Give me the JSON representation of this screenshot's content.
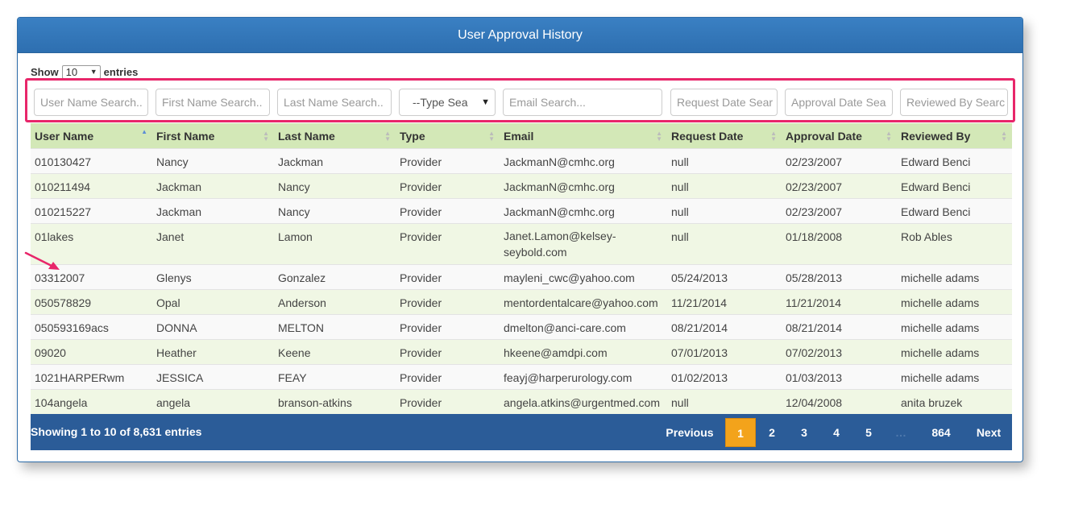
{
  "title": "User Approval History",
  "show_entries": {
    "show_label": "Show",
    "value": "10",
    "entries_label": "entries"
  },
  "filters": [
    {
      "placeholder": "User Name Search..",
      "type": "text"
    },
    {
      "placeholder": "First Name Search..",
      "type": "text"
    },
    {
      "placeholder": "Last Name Search..",
      "type": "text"
    },
    {
      "placeholder": "--Type Sea",
      "type": "select"
    },
    {
      "placeholder": "Email Search...",
      "type": "text"
    },
    {
      "placeholder": "Request Date Sear",
      "type": "text"
    },
    {
      "placeholder": "Approval Date Sea",
      "type": "text"
    },
    {
      "placeholder": "Reviewed By Searc",
      "type": "text"
    }
  ],
  "columns": [
    "User Name",
    "First Name",
    "Last Name",
    "Type",
    "Email",
    "Request Date",
    "Approval Date",
    "Reviewed By"
  ],
  "rows": [
    [
      "010130427",
      "Nancy",
      "Jackman",
      "Provider",
      "JackmanN@cmhc.org",
      "null",
      "02/23/2007",
      "Edward Benci"
    ],
    [
      "010211494",
      "Jackman",
      "Nancy",
      "Provider",
      "JackmanN@cmhc.org",
      "null",
      "02/23/2007",
      "Edward Benci"
    ],
    [
      "010215227",
      "Jackman",
      "Nancy",
      "Provider",
      "JackmanN@cmhc.org",
      "null",
      "02/23/2007",
      "Edward Benci"
    ],
    [
      "01lakes",
      "Janet",
      "Lamon",
      "Provider",
      "Janet.Lamon@kelsey-seybold.com",
      "null",
      "01/18/2008",
      "Rob Ables"
    ],
    [
      "03312007",
      "Glenys",
      "Gonzalez",
      "Provider",
      "mayleni_cwc@yahoo.com",
      "05/24/2013",
      "05/28/2013",
      "michelle adams"
    ],
    [
      "050578829",
      "Opal",
      "Anderson",
      "Provider",
      "mentordentalcare@yahoo.com",
      "11/21/2014",
      "11/21/2014",
      "michelle adams"
    ],
    [
      "050593169acs",
      "DONNA",
      "MELTON",
      "Provider",
      "dmelton@anci-care.com",
      "08/21/2014",
      "08/21/2014",
      "michelle adams"
    ],
    [
      "09020",
      "Heather",
      "Keene",
      "Provider",
      "hkeene@amdpi.com",
      "07/01/2013",
      "07/02/2013",
      "michelle adams"
    ],
    [
      "1021HARPERwm",
      "JESSICA",
      "FEAY",
      "Provider",
      "feayj@harperurology.com",
      "01/02/2013",
      "01/03/2013",
      "michelle adams"
    ],
    [
      "104angela",
      "angela",
      "branson-atkins",
      "Provider",
      "angela.atkins@urgentmed.com",
      "null",
      "12/04/2008",
      "anita bruzek"
    ]
  ],
  "footer": {
    "info": "Showing 1 to 10 of 8,631 entries",
    "previous": "Previous",
    "pages": [
      "1",
      "2",
      "3",
      "4",
      "5"
    ],
    "ellipsis": "…",
    "last_page": "864",
    "next": "Next",
    "current_page": "1"
  },
  "colors": {
    "header": "#2e6fb0",
    "highlight_box": "#e8266a",
    "current_page": "#f3a31b",
    "footer": "#2b5c98"
  }
}
